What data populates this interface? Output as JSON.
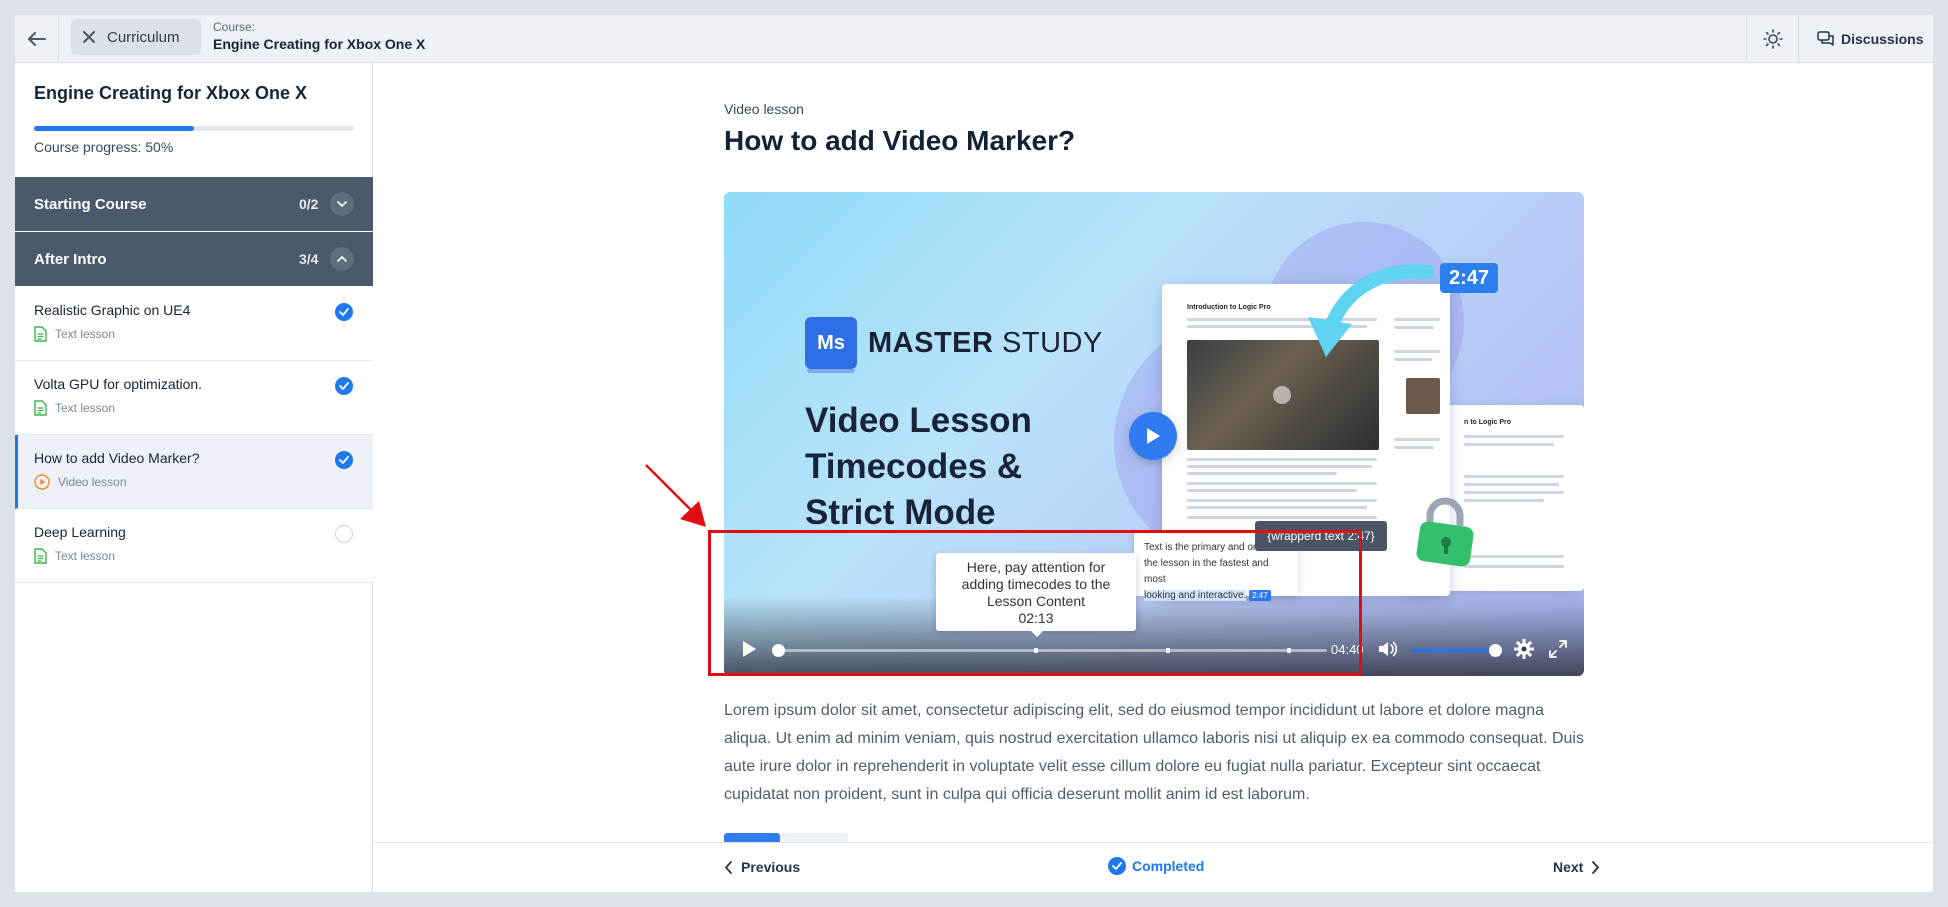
{
  "header": {
    "back_icon": "arrow-left-icon",
    "curriculum_label": "Curriculum",
    "course_label": "Course:",
    "course_title": "Engine Creating for Xbox One X",
    "theme_icon": "sun-icon",
    "discussions_label": "Discussions"
  },
  "sidebar": {
    "course_title": "Engine Creating for Xbox One X",
    "progress_percent": 50,
    "progress_text": "Course progress: 50%",
    "sections": [
      {
        "name": "Starting Course",
        "count": "0/2",
        "expanded": false
      },
      {
        "name": "After Intro",
        "count": "3/4",
        "expanded": true
      }
    ],
    "lessons": [
      {
        "title": "Realistic Graphic on UE4",
        "type": "Text lesson",
        "completed": true,
        "active": false
      },
      {
        "title": "Volta GPU for optimization.",
        "type": "Text lesson",
        "completed": true,
        "active": false
      },
      {
        "title": "How to add Video Marker?",
        "type": "Video lesson",
        "completed": true,
        "active": true
      },
      {
        "title": "Deep Learning",
        "type": "Text lesson",
        "completed": false,
        "active": false
      }
    ]
  },
  "main": {
    "lesson_type": "Video lesson",
    "title": "How to add Video Marker?",
    "video": {
      "brand_initials": "Ms",
      "brand_name_bold": "MASTER",
      "brand_name_light": "STUDY",
      "heading_lines": [
        "Video Lesson",
        "Timecodes &",
        "Strict Mode"
      ],
      "mock_title": "Introduction to Logic Pro",
      "side_mock_title": "n to Logic Pro",
      "timecode_badge": "2:47",
      "dark_tooltip": "{wrapperd text 2:47}",
      "text_tooltip_a": "Text is the primary and on",
      "text_tooltip_b": "the lesson in the fastest and most",
      "text_tooltip_c": "looking and interactive.",
      "text_tooltip_chip": "2:47",
      "marker_tooltip_text": "Here, pay attention for adding timecodes to the Lesson Content",
      "marker_tooltip_time": "02:13",
      "progress_fraction": 0,
      "marker_fractions": [
        0.47,
        0.71,
        0.93
      ],
      "duration": "04:40",
      "volume_fraction": 1
    },
    "paragraph": "Lorem ipsum dolor sit amet, consectetur adipiscing elit, sed do eiusmod tempor incididunt ut labore et dolore magna aliqua. Ut enim ad minim veniam, quis nostrud exercitation ullamco laboris nisi ut aliquip ex ea commodo consequat. Duis aute irure dolor in reprehenderit in voluptate velit esse cillum dolore eu fugiat nulla pariatur. Excepteur sint occaecat cupidatat non proident, sunt in culpa qui officia deserunt mollit anim id est laborum."
  },
  "footer": {
    "previous_label": "Previous",
    "completed_label": "Completed",
    "next_label": "Next"
  },
  "colors": {
    "accent": "#1f78f0",
    "section_bg": "#4b5a6a",
    "annotation_red": "#e00d12"
  }
}
